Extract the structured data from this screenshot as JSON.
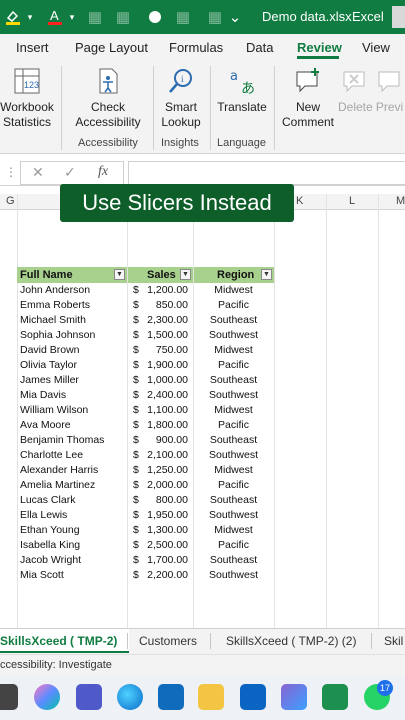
{
  "titlebar": {
    "filename": "Demo data.xlsx",
    "separator": "-",
    "app": "Excel"
  },
  "ribbon_tabs": [
    "Insert",
    "Page Layout",
    "Formulas",
    "Data",
    "Review",
    "View"
  ],
  "ribbon": {
    "workbook_statistics": "Workbook Statistics",
    "check_accessibility": "Check Accessibility",
    "smart_lookup": "Smart Lookup",
    "translate": "Translate",
    "new_comment": "New Comment",
    "delete": "Delete",
    "previous": "Previ",
    "groups": {
      "accessibility": "Accessibility",
      "insights": "Insights",
      "language": "Language"
    }
  },
  "formula_bar": {
    "more": "⋮",
    "cancel": "✕",
    "enter": "✓",
    "fx": "fx"
  },
  "columns": [
    "G",
    "K",
    "L",
    "M"
  ],
  "banner": "Use Slicers Instead",
  "table": {
    "headers": {
      "name": "Full Name",
      "sales": "Sales",
      "region": "Region"
    },
    "currency": "$",
    "rows": [
      {
        "name": "John Anderson",
        "sales": "1,200.00",
        "region": "Midwest"
      },
      {
        "name": "Emma Roberts",
        "sales": "850.00",
        "region": "Pacific"
      },
      {
        "name": "Michael Smith",
        "sales": "2,300.00",
        "region": "Southeast"
      },
      {
        "name": "Sophia Johnson",
        "sales": "1,500.00",
        "region": "Southwest"
      },
      {
        "name": "David Brown",
        "sales": "750.00",
        "region": "Midwest"
      },
      {
        "name": "Olivia Taylor",
        "sales": "1,900.00",
        "region": "Pacific"
      },
      {
        "name": "James Miller",
        "sales": "1,000.00",
        "region": "Southeast"
      },
      {
        "name": "Mia Davis",
        "sales": "2,400.00",
        "region": "Southwest"
      },
      {
        "name": "William Wilson",
        "sales": "1,100.00",
        "region": "Midwest"
      },
      {
        "name": "Ava Moore",
        "sales": "1,800.00",
        "region": "Pacific"
      },
      {
        "name": "Benjamin Thomas",
        "sales": "900.00",
        "region": "Southeast"
      },
      {
        "name": "Charlotte Lee",
        "sales": "2,100.00",
        "region": "Southwest"
      },
      {
        "name": "Alexander Harris",
        "sales": "1,250.00",
        "region": "Midwest"
      },
      {
        "name": "Amelia Martinez",
        "sales": "2,000.00",
        "region": "Pacific"
      },
      {
        "name": "Lucas Clark",
        "sales": "800.00",
        "region": "Southeast"
      },
      {
        "name": "Ella Lewis",
        "sales": "1,950.00",
        "region": "Southwest"
      },
      {
        "name": "Ethan Young",
        "sales": "1,300.00",
        "region": "Midwest"
      },
      {
        "name": "Isabella King",
        "sales": "2,500.00",
        "region": "Pacific"
      },
      {
        "name": "Jacob Wright",
        "sales": "1,700.00",
        "region": "Southeast"
      },
      {
        "name": "Mia Scott",
        "sales": "2,200.00",
        "region": "Southwest"
      }
    ]
  },
  "sheet_tabs": [
    "SkillsXceed ( TMP-2)",
    "Customers",
    "SkillsXceed ( TMP-2) (2)",
    "Skil"
  ],
  "status": "ccessibility: Investigate",
  "taskbar_badge": "17",
  "colors": {
    "excel_green": "#107c41",
    "header_fill": "#a9d18e",
    "banner": "#0e5e2a"
  }
}
